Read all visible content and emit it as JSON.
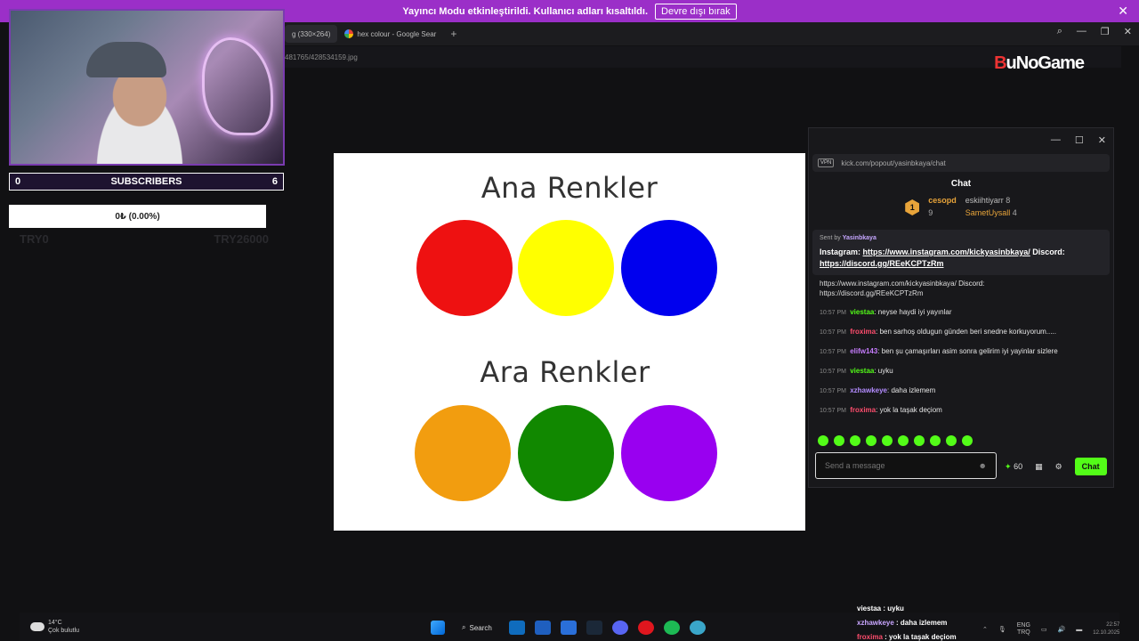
{
  "banner": {
    "text": "Yayıncı Modu etkinleştirildi. Kullanıcı adları kısaltıldı.",
    "button_label": "Devre dışı bırak"
  },
  "browser": {
    "tabs": [
      {
        "label": "g (330×264)"
      },
      {
        "label": "hex colour - Google Sear"
      }
    ],
    "address": "481765/428534159.jpg",
    "brand_prefix": "B",
    "brand_rest": "uNoGame"
  },
  "overlay": {
    "subs_left": "0",
    "subs_label": "SUBSCRIBERS",
    "subs_right": "6",
    "donation": "0₺ (0.00%)",
    "ghost_left": "TRY0",
    "ghost_right": "TRY26000"
  },
  "image": {
    "title_top": "Ana Renkler",
    "title_bottom": "Ara Renkler",
    "colors": {
      "red": "#ee1111",
      "yellow": "#ffff00",
      "blue": "#0000ee",
      "orange": "#f29d0f",
      "green": "#118800",
      "purple": "#9900f0"
    }
  },
  "chat": {
    "url": "kick.com/popout/yasinbkaya/chat",
    "title": "Chat",
    "leaders": [
      {
        "name": "cesopd",
        "count": "9"
      },
      {
        "name": "eskiihtiyarr",
        "count": "8"
      },
      {
        "name": "SametUysall",
        "count": "4"
      }
    ],
    "pinned": {
      "sent_by_label": "Sent by",
      "sent_by_user": "Yasinbkaya",
      "prefix": "Instagram: ",
      "instagram_link": "https://www.instagram.com/kickyasinbkaya/",
      "middle": " Discord: ",
      "discord_link": "https://discord.gg/REeKCPTzRm"
    },
    "prev_line": {
      "link1": "https://www.instagram.com/kickyasinbkaya/",
      "middle": " Discord:",
      "link2": "https://discord.gg/REeKCPTzRm"
    },
    "messages": [
      {
        "time": "10:57 PM",
        "user": "viestaa",
        "color": "#53fc18",
        "text": "neyse haydi iyi yayınlar"
      },
      {
        "time": "10:57 PM",
        "user": "froxima",
        "color": "#ff4d6d",
        "text": "ben sarhoş oldugun günden beri snedne korkuyorum....."
      },
      {
        "time": "10:57 PM",
        "user": "elifw143",
        "color": "#c77dff",
        "text": "ben şu çamaşırları asim sonra gelirim iyi yayinlar sizlere"
      },
      {
        "time": "10:57 PM",
        "user": "viestaa",
        "color": "#53fc18",
        "text": "uyku"
      },
      {
        "time": "10:57 PM",
        "user": "xzhawkeye",
        "color": "#b38cff",
        "text": "daha izlemem"
      },
      {
        "time": "10:57 PM",
        "user": "froxima",
        "color": "#ff4d6d",
        "text": "yok la taşak deçiom"
      }
    ],
    "input_placeholder": "Send a message",
    "points": "60",
    "send_label": "Chat",
    "accent": "#53fc18"
  },
  "taskbar": {
    "temp": "14°C",
    "weather": "Çok bulutlu",
    "search_label": "Search",
    "lang": "ENG",
    "region": "TRQ",
    "time": "22:57",
    "date": "12.10.2025",
    "overlay_chat": [
      {
        "user": "viestaa",
        "color": "#ffffff",
        "text": "uyku"
      },
      {
        "user": "xzhawkeye",
        "color": "#c9a6ff",
        "text": "daha izlemem"
      },
      {
        "user": "froxima",
        "color": "#ff4d6d",
        "text": "yok la taşak deçiom"
      }
    ]
  }
}
